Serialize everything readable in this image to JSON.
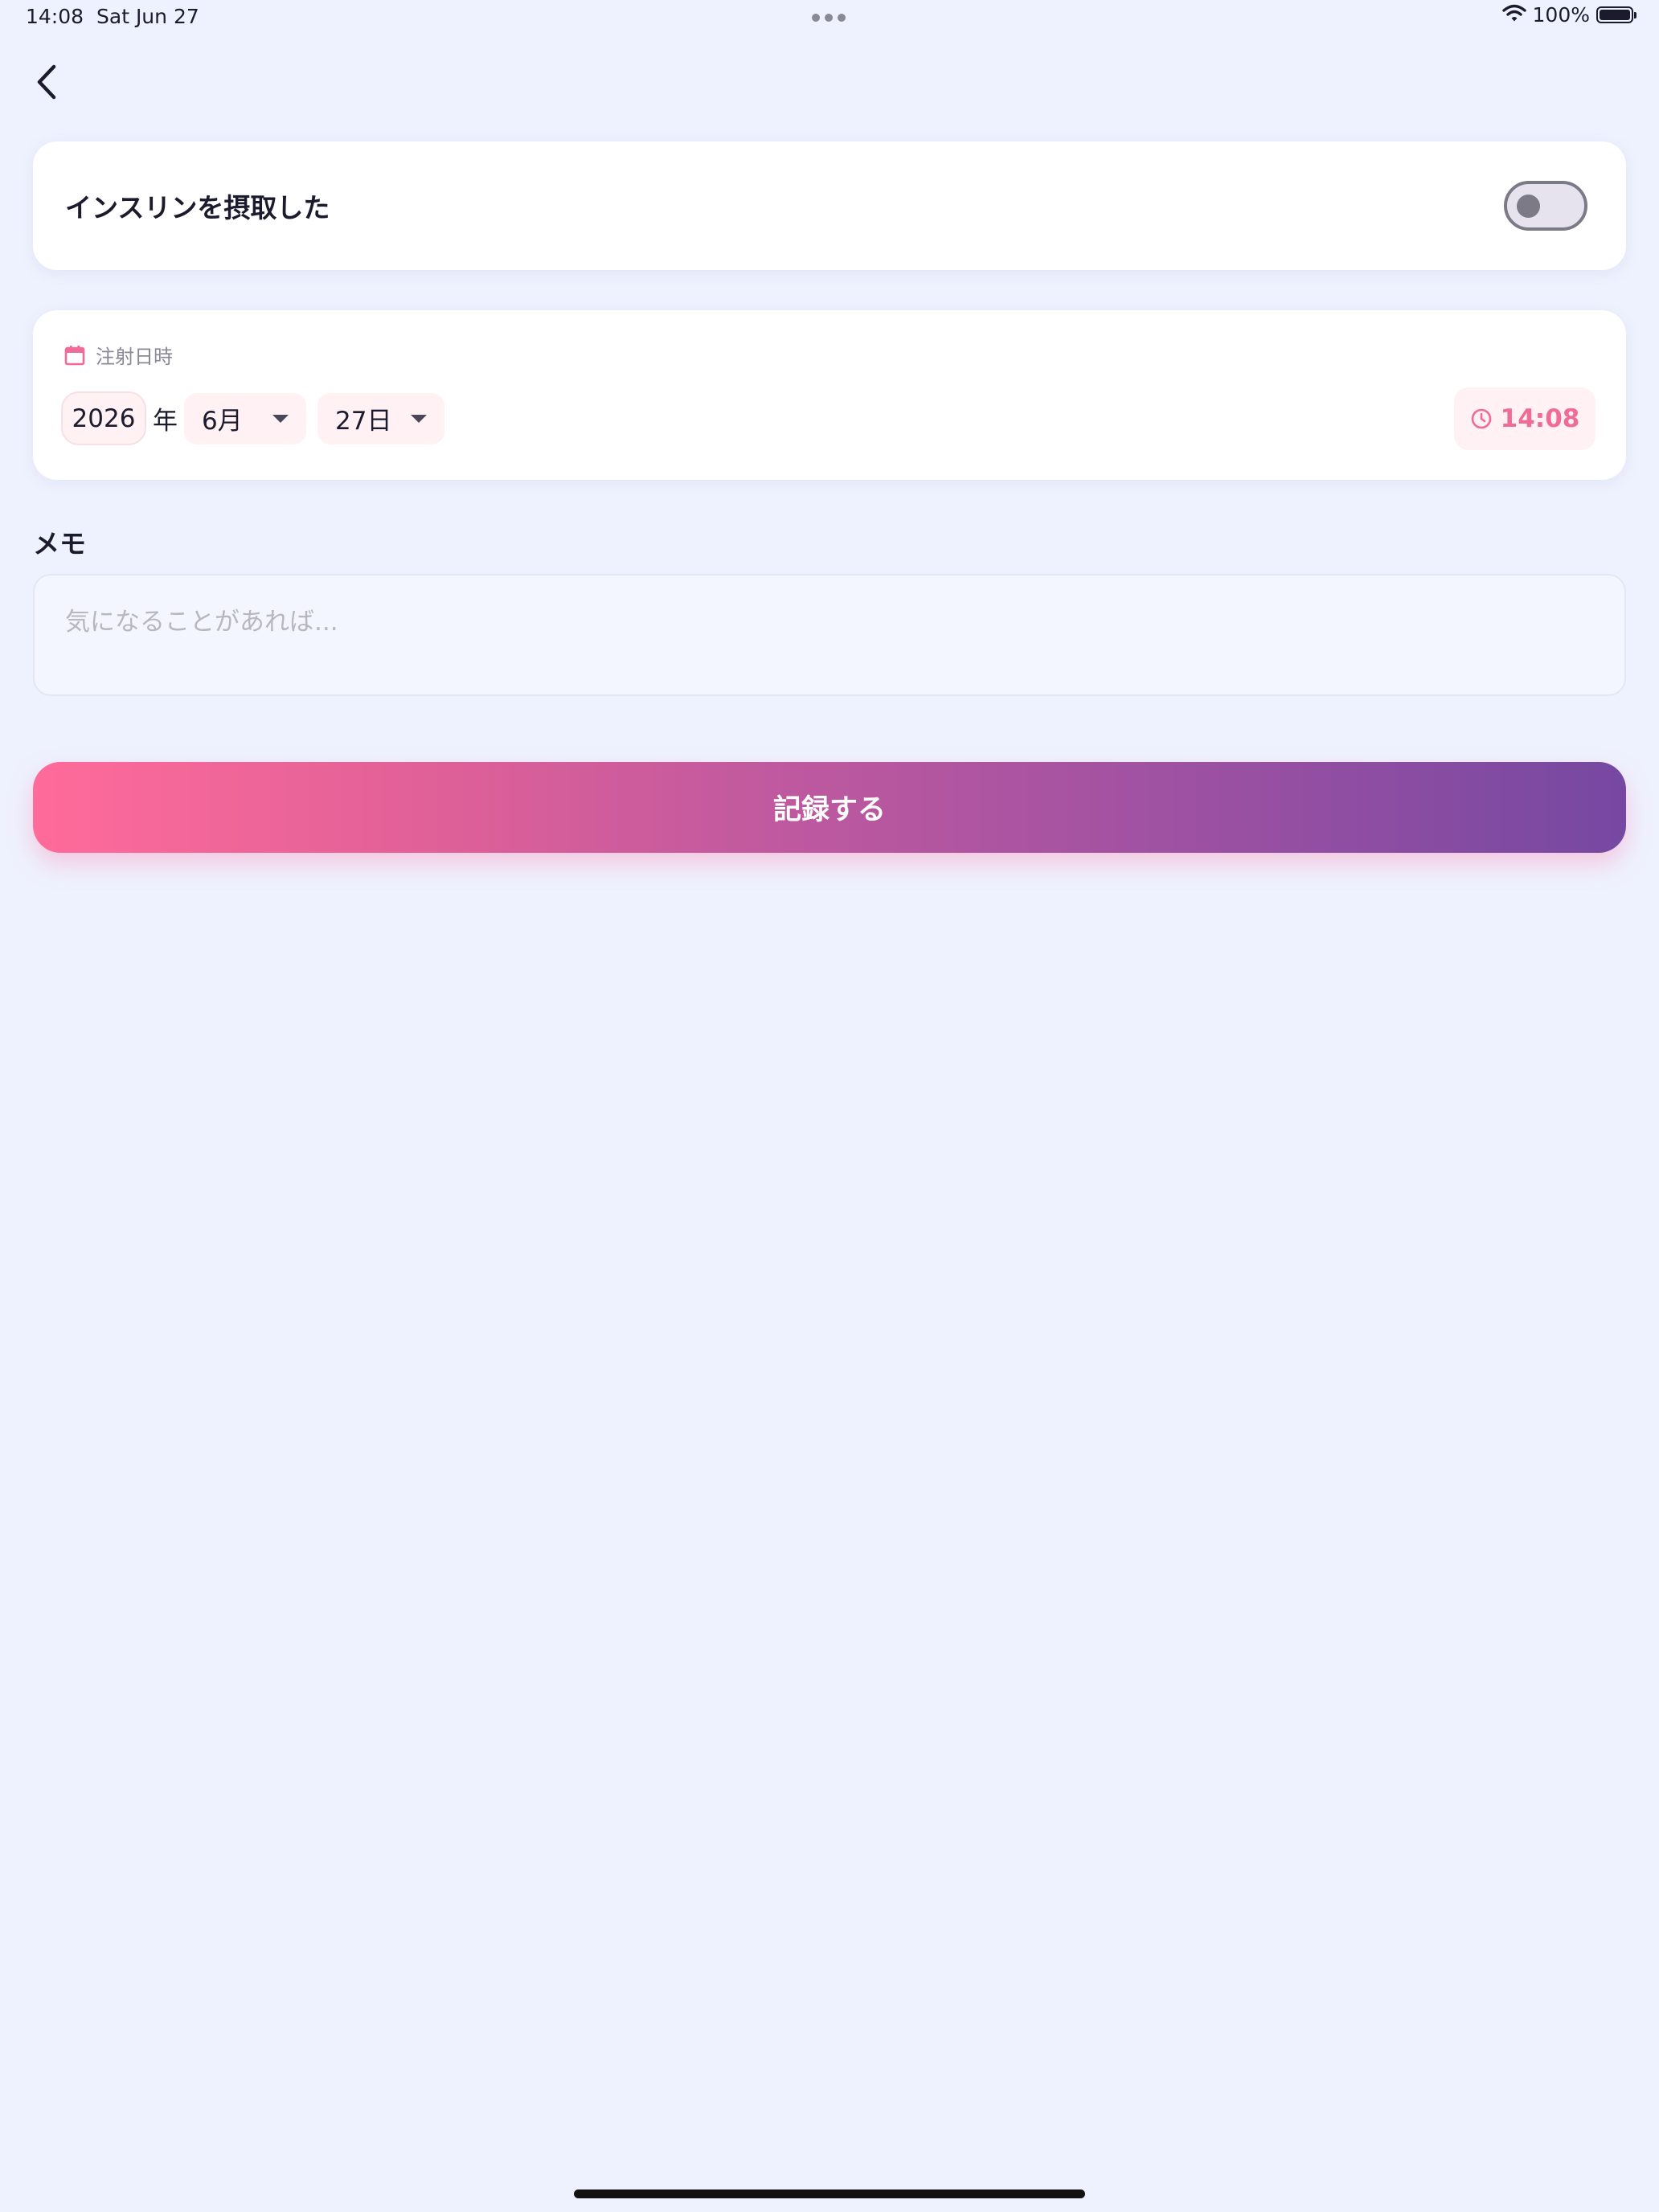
{
  "status_bar": {
    "time": "14:08",
    "date": "Sat Jun 27",
    "battery_percent": "100%",
    "battery_level": 1.0,
    "icons": [
      "wifi-icon",
      "battery-icon"
    ]
  },
  "nav": {
    "back_icon": "chevron-left-icon"
  },
  "insulin": {
    "label": "インスリンを摂取した",
    "toggle_on": false
  },
  "datetime": {
    "icon": "calendar-icon",
    "label": "注射日時",
    "year": "2026",
    "year_suffix": "年",
    "month": "6月",
    "day": "27日",
    "time_icon": "clock-icon",
    "time": "14:08"
  },
  "memo": {
    "label": "メモ",
    "placeholder": "気になることがあれば..."
  },
  "submit": {
    "label": "記録する"
  },
  "colors": {
    "background": "#eef2fe",
    "accent_pink": "#f06b97",
    "gradient_start": "#ff6b9a",
    "gradient_end": "#7648a2",
    "chip_bg": "#fff1f4"
  }
}
